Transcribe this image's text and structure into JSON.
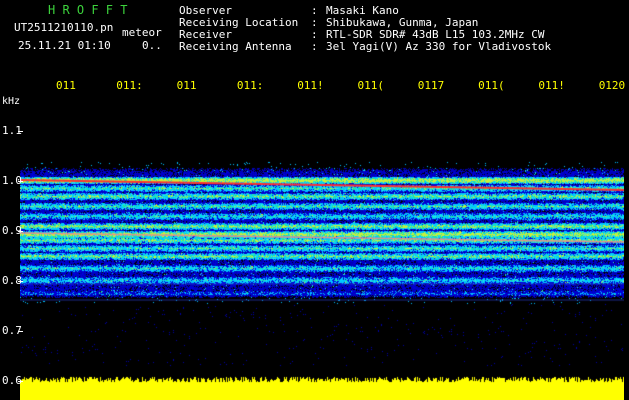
{
  "header": {
    "title": "H R O F F T",
    "file_name": "UT2511210110.pn",
    "file_tag": "meteor",
    "datetime": "25.11.21 01:10",
    "counter": "0..",
    "fields": [
      {
        "label": "Observer",
        "value": "Masaki Kano"
      },
      {
        "label": "Receiving Location",
        "value": "Shibukawa, Gunma, Japan"
      },
      {
        "label": "Receiver",
        "value": "RTL-SDR SDR# 43dB L15 103.2MHz CW"
      },
      {
        "label": "Receiving Antenna",
        "value": "3el Yagi(V) Az 330 for Vladivostok"
      }
    ]
  },
  "time_axis": {
    "labels": [
      "011",
      "011:",
      "011",
      "011:",
      "011!",
      "011(",
      "0117",
      "011(",
      "011!",
      "0120"
    ]
  },
  "freq_axis": {
    "unit": "kHz",
    "ticks": [
      "1.1",
      "1.0",
      "0.9",
      "0.8",
      "0.7",
      "0.6"
    ]
  },
  "colors": {
    "title": "#3cd23c",
    "header_text": "#ffffff",
    "time_labels": "#ffff00",
    "carrier_line": "#ff3030",
    "noise_floor": "#ffff00"
  }
}
